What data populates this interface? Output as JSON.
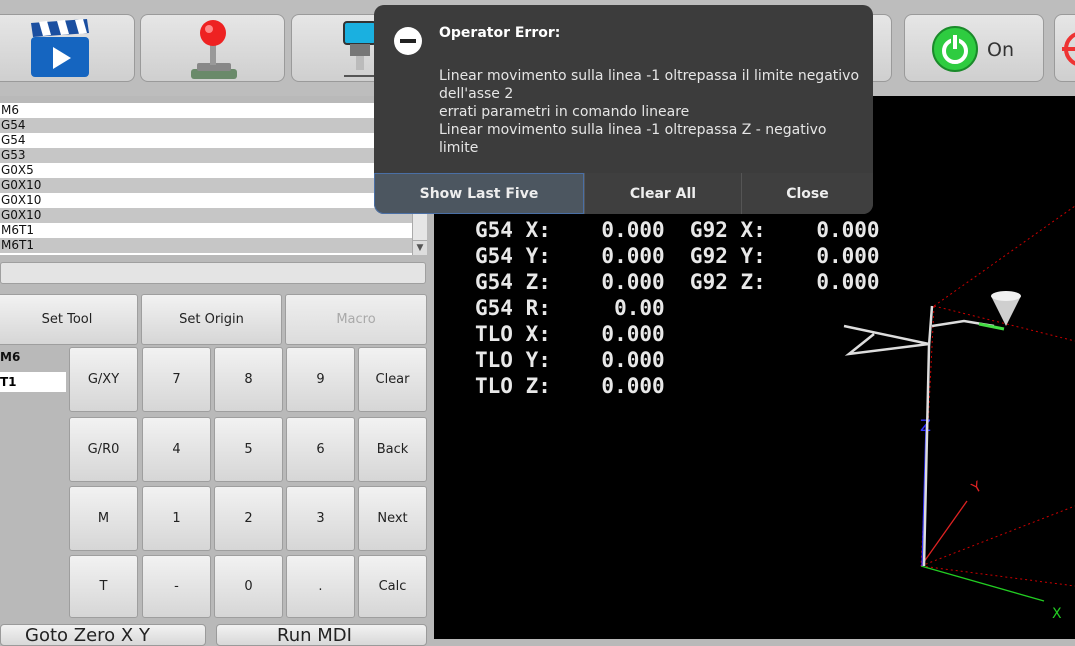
{
  "toolbar": {
    "power_label": "On"
  },
  "history": {
    "lines": [
      "M6",
      "G54",
      "G54",
      "G53",
      "G0X5",
      "G0X10",
      "G0X10",
      "G0X10",
      "M6T1",
      "M6T1"
    ]
  },
  "buttons": {
    "set_tool": "Set Tool",
    "set_origin": "Set Origin",
    "macro": "Macro"
  },
  "mdi": {
    "current_code": "M6",
    "tool_value": "T1"
  },
  "keypad": [
    [
      "G/XY",
      "7",
      "8",
      "9",
      "Clear"
    ],
    [
      "G/R0",
      "4",
      "5",
      "6",
      "Back"
    ],
    [
      "M",
      "1",
      "2",
      "3",
      "Next"
    ],
    [
      "T",
      "-",
      "0",
      ".",
      "Calc"
    ]
  ],
  "bottom": {
    "left": "Goto Zero X Y",
    "right": "Run MDI"
  },
  "dro": [
    "G54 X:    0.000  G92 X:    0.000",
    "G54 Y:    0.000  G92 Y:    0.000",
    "G54 Z:    0.000  G92 Z:    0.000",
    "G54 R:     0.00",
    "TLO X:    0.000",
    "TLO Y:    0.000",
    "TLO Z:    0.000"
  ],
  "dialog": {
    "title": "Operator Error:",
    "message_lines": [
      "Linear movimento sulla linea -1 oltrepassa il limite negativo dell'asse 2",
      "errati parametri in comando lineare",
      "Linear movimento sulla linea -1 oltrepassa Z - negativo limite"
    ],
    "buttons": [
      "Show Last Five",
      "Clear All",
      "Close"
    ]
  },
  "colors": {
    "dialog_bg": "#3c3c3c",
    "accent": "#4a6fa5",
    "power_green": "#2ecc40"
  }
}
